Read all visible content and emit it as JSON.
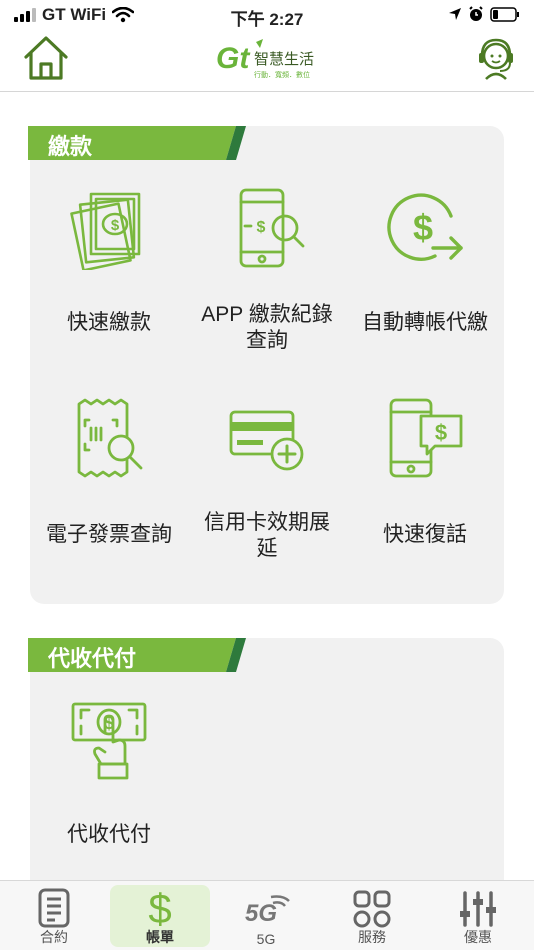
{
  "status_bar": {
    "carrier": "GT WiFi",
    "time": "下午 2:27"
  },
  "header": {
    "logo_text": "智慧生活",
    "logo_tagline": "行動．寬頻．數位"
  },
  "colors": {
    "brand_green": "#7ab83e",
    "dark_green": "#2e7a3c",
    "active_tab_bg": "#e4f2d6"
  },
  "sections": [
    {
      "title": "繳款",
      "items": [
        {
          "label_lines": [
            "快速繳款"
          ],
          "icon": "cash-icon"
        },
        {
          "label_lines": [
            "APP 繳款紀錄",
            "查詢"
          ],
          "icon": "phone-search-icon"
        },
        {
          "label_lines": [
            "自動轉帳代繳"
          ],
          "icon": "dollar-transfer-icon"
        },
        {
          "label_lines": [
            "電子發票查詢"
          ],
          "icon": "invoice-search-icon"
        },
        {
          "label_lines": [
            "信用卡效期展",
            "延"
          ],
          "icon": "credit-card-add-icon"
        },
        {
          "label_lines": [
            "快速復話"
          ],
          "icon": "phone-chat-dollar-icon"
        }
      ]
    },
    {
      "title": "代收代付",
      "items": [
        {
          "label_lines": [
            "代收代付"
          ],
          "icon": "hand-cash-icon"
        }
      ]
    }
  ],
  "tabs": [
    {
      "label": "合約",
      "icon": "contract-icon",
      "active": false
    },
    {
      "label": "帳單",
      "icon": "dollar-icon",
      "active": true
    },
    {
      "label": "5G",
      "icon": "5g-icon",
      "active": false
    },
    {
      "label": "服務",
      "icon": "grid-icon",
      "active": false
    },
    {
      "label": "優惠",
      "icon": "sliders-icon",
      "active": false
    }
  ]
}
